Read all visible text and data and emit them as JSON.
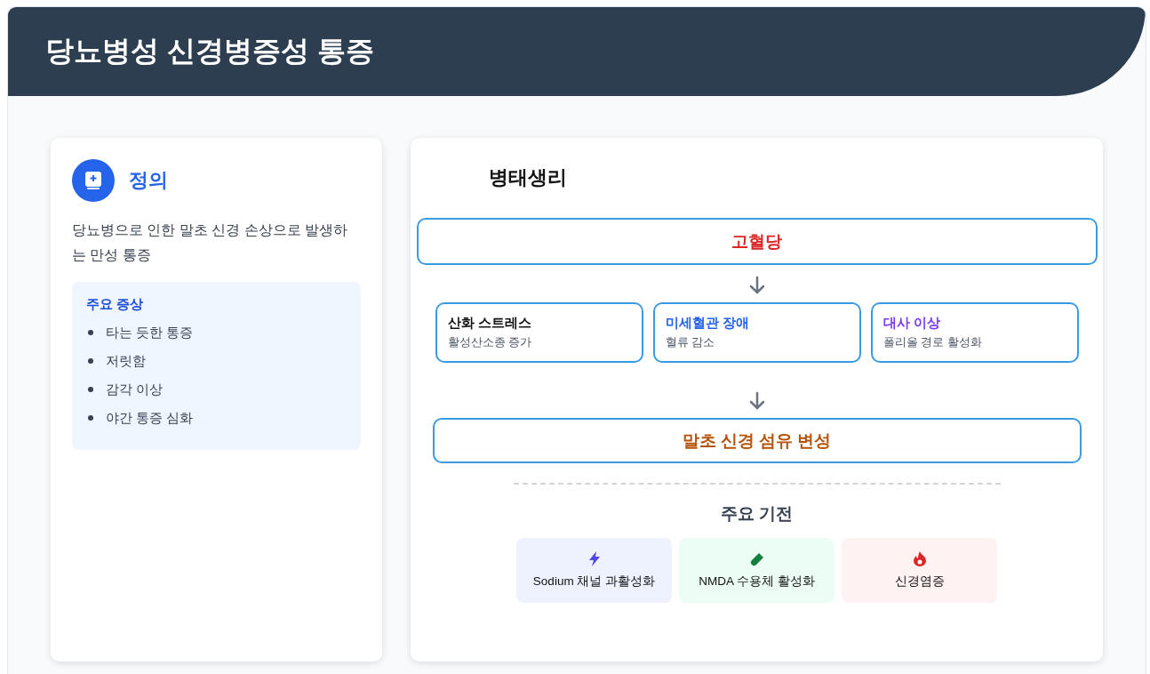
{
  "header": {
    "title": "당뇨병성 신경병증성 통증"
  },
  "definition": {
    "title": "정의",
    "text": "당뇨병으로 인한 말초 신경 손상으로 발생하는 만성 통증",
    "symptoms_title": "주요 증상",
    "symptoms": [
      "타는 듯한 통증",
      "저릿함",
      "감각 이상",
      "야간 통증 심화"
    ]
  },
  "pathophysiology": {
    "title": "병태생리",
    "top": "고혈당",
    "causes": [
      {
        "title": "산화 스트레스",
        "subtitle": "활성산소종 증가",
        "color": "#111111"
      },
      {
        "title": "미세혈관 장애",
        "subtitle": "혈류 감소",
        "color": "#2563eb"
      },
      {
        "title": "대사 이상",
        "subtitle": "폴리올 경로 활성화",
        "color": "#7c3aed"
      }
    ],
    "result": "말초 신경 섬유 변성",
    "mechanisms_title": "주요 기전",
    "mechanisms": [
      {
        "kind": "bolt",
        "label": "Sodium 채널 과활성화",
        "color": "#eef2ff"
      },
      {
        "kind": "vial",
        "label": "NMDA 수용체 활성화",
        "color": "#ecfdf5"
      },
      {
        "kind": "fire",
        "label": "신경염증",
        "color": "#fef2f2"
      }
    ]
  }
}
